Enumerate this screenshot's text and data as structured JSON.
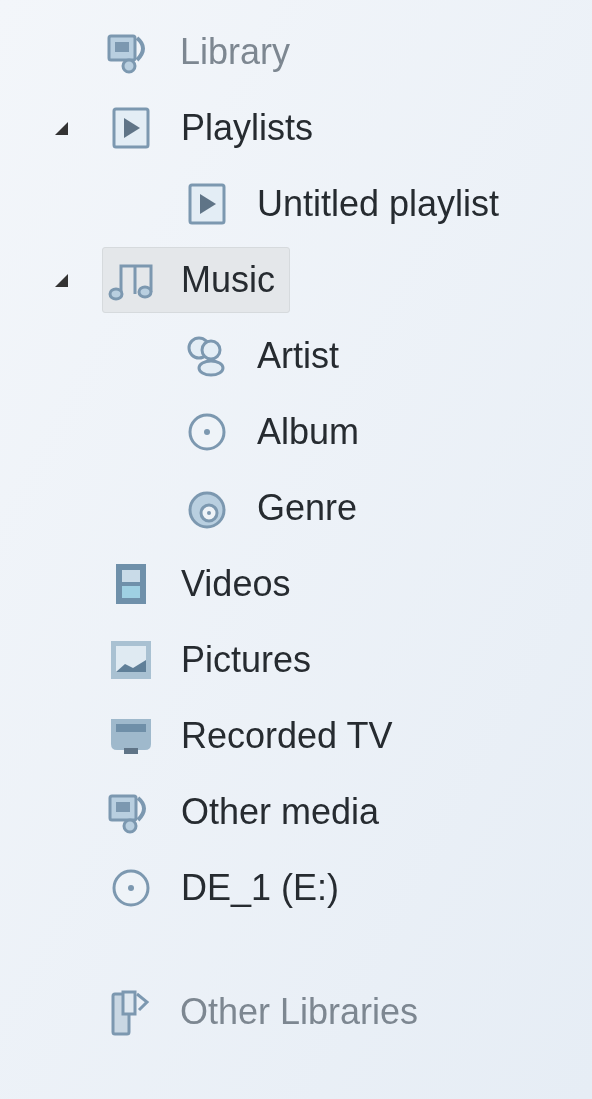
{
  "sections": [
    {
      "title": "Library",
      "kind": "library",
      "items": [
        {
          "label": "Playlists",
          "kind": "playlist",
          "selected": false,
          "expanded": true,
          "children": [
            {
              "label": "Untitled playlist",
              "kind": "playlist",
              "selected": false
            }
          ]
        },
        {
          "label": "Music",
          "kind": "music",
          "selected": true,
          "expanded": true,
          "children": [
            {
              "label": "Artist",
              "kind": "artist",
              "selected": false
            },
            {
              "label": "Album",
              "kind": "album",
              "selected": false
            },
            {
              "label": "Genre",
              "kind": "genre",
              "selected": false
            }
          ]
        },
        {
          "label": "Videos",
          "kind": "video",
          "selected": false
        },
        {
          "label": "Pictures",
          "kind": "picture",
          "selected": false
        },
        {
          "label": "Recorded TV",
          "kind": "tv",
          "selected": false
        },
        {
          "label": "Other media",
          "kind": "library",
          "selected": false
        },
        {
          "label": "DE_1 (E:)",
          "kind": "disc",
          "selected": false
        }
      ]
    },
    {
      "title": "Other Libraries",
      "kind": "other-libraries"
    }
  ]
}
